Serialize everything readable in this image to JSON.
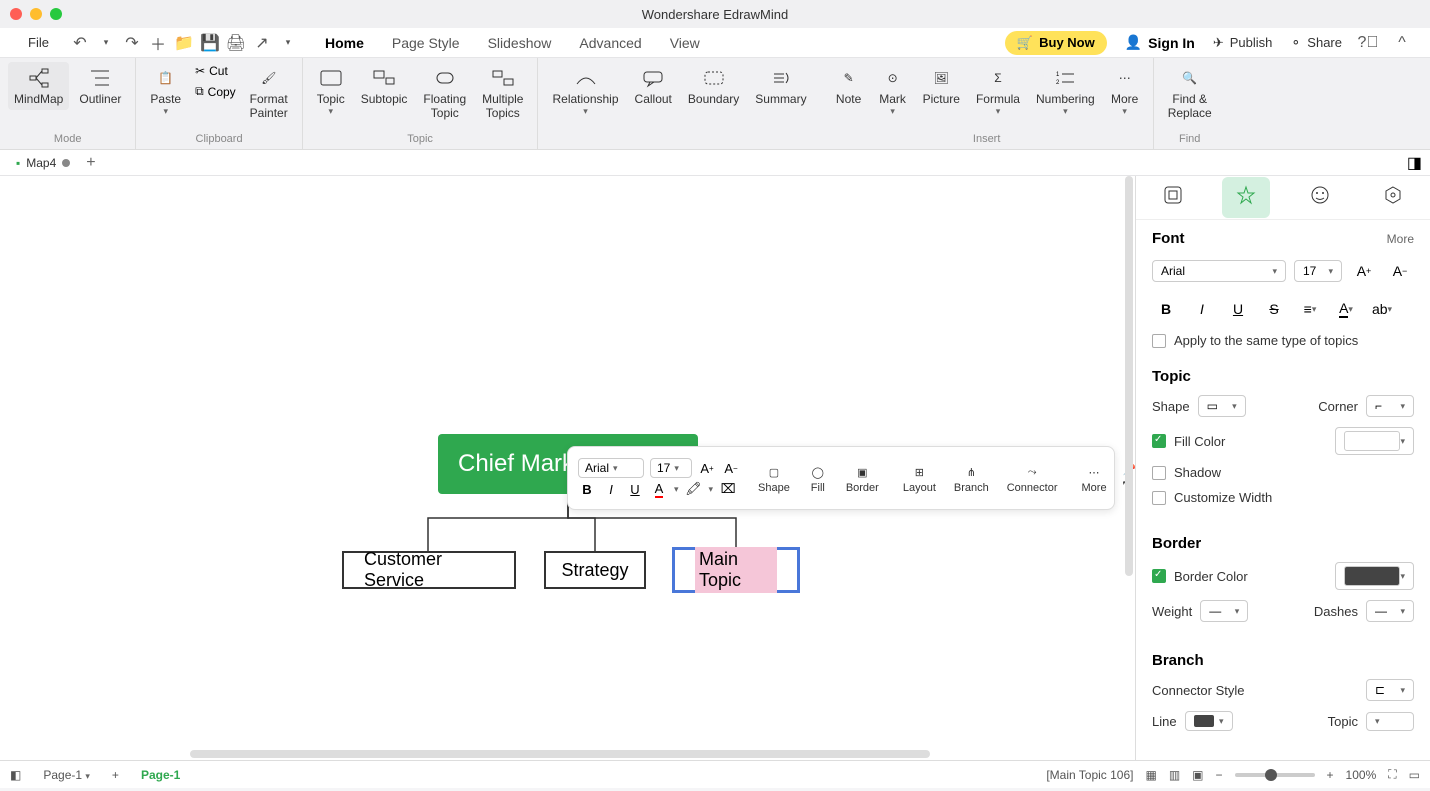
{
  "app": {
    "title": "Wondershare EdrawMind"
  },
  "menu": {
    "file": "File",
    "tabs": [
      "Home",
      "Page Style",
      "Slideshow",
      "Advanced",
      "View"
    ],
    "active": 0
  },
  "actions": {
    "buynow": "Buy Now",
    "signin": "Sign In",
    "publish": "Publish",
    "share": "Share"
  },
  "ribbon": {
    "mode": {
      "mindmap": "MindMap",
      "outliner": "Outliner",
      "label": "Mode"
    },
    "clipboard": {
      "paste": "Paste",
      "cut": "Cut",
      "copy": "Copy",
      "format": "Format\nPainter",
      "label": "Clipboard"
    },
    "topic": {
      "topic": "Topic",
      "subtopic": "Subtopic",
      "floating": "Floating\nTopic",
      "multiple": "Multiple\nTopics",
      "label": "Topic"
    },
    "rel": {
      "relationship": "Relationship",
      "callout": "Callout",
      "boundary": "Boundary",
      "summary": "Summary"
    },
    "insert": {
      "note": "Note",
      "mark": "Mark",
      "picture": "Picture",
      "formula": "Formula",
      "numbering": "Numbering",
      "more": "More",
      "label": "Insert"
    },
    "find": {
      "find": "Find &\nReplace",
      "label": "Find"
    }
  },
  "doctab": {
    "name": "Map4"
  },
  "canvas": {
    "root": "Chief Mark",
    "child1": "Customer Service",
    "child2": "Strategy",
    "child3": "Main Topic"
  },
  "floatbar": {
    "font": "Arial",
    "size": "17",
    "shape": "Shape",
    "fill": "Fill",
    "border": "Border",
    "layout": "Layout",
    "branch": "Branch",
    "connector": "Connector",
    "more": "More"
  },
  "side": {
    "font": {
      "title": "Font",
      "more": "More",
      "family": "Arial",
      "size": "17",
      "apply": "Apply to the same type of topics"
    },
    "topic": {
      "title": "Topic",
      "shape": "Shape",
      "corner": "Corner",
      "fill": "Fill Color",
      "shadow": "Shadow",
      "custom": "Customize Width"
    },
    "border": {
      "title": "Border",
      "color": "Border Color",
      "weight": "Weight",
      "dashes": "Dashes"
    },
    "branch": {
      "title": "Branch",
      "connector": "Connector Style",
      "line": "Line",
      "topic": "Topic"
    }
  },
  "status": {
    "page": "Page-1",
    "pagetab": "Page-1",
    "info": "[Main Topic 106]",
    "zoom": "100%"
  }
}
